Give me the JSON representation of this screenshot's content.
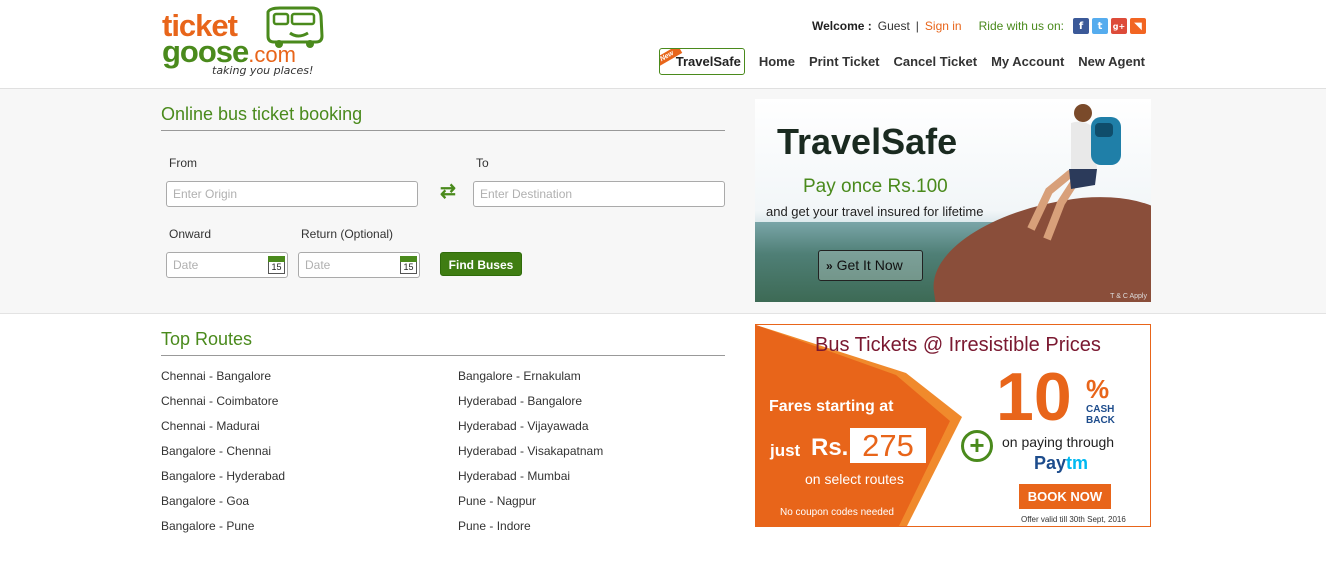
{
  "logo": {
    "line1": "ticket",
    "line2": "goose",
    "dotcom": ".com",
    "tagline": "taking you places!"
  },
  "header": {
    "welcome_label": "Welcome :",
    "user": "Guest",
    "separator": "|",
    "signin": "Sign in",
    "ride_label": "Ride with us on:",
    "social": [
      {
        "icon": "facebook-icon",
        "glyph": "f"
      },
      {
        "icon": "twitter-icon",
        "glyph": "t"
      },
      {
        "icon": "googleplus-icon",
        "glyph": "g+"
      },
      {
        "icon": "rss-icon",
        "glyph": "◥"
      }
    ]
  },
  "nav": {
    "badge": "New",
    "travelsafe": "TravelSafe",
    "items": [
      "Home",
      "Print Ticket",
      "Cancel Ticket",
      "My Account",
      "New Agent"
    ]
  },
  "search": {
    "title": "Online bus ticket booking",
    "from_label": "From",
    "to_label": "To",
    "origin_placeholder": "Enter Origin",
    "destination_placeholder": "Enter Destination",
    "onward_label": "Onward",
    "return_label": "Return (Optional)",
    "date_placeholder": "Date",
    "calendar_day": "15",
    "find_button": "Find Buses",
    "swap_glyph": "⇄"
  },
  "travelsafe_banner": {
    "title": "TravelSafe",
    "pay_line": "Pay once Rs.100",
    "sub_line": "and get your travel insured for lifetime",
    "cta_arrows": "»",
    "cta": "Get It Now",
    "terms": "T & C Apply"
  },
  "routes": {
    "title": "Top Routes",
    "left": [
      "Chennai - Bangalore",
      "Chennai - Coimbatore",
      "Chennai - Madurai",
      "Bangalore - Chennai",
      "Bangalore - Hyderabad",
      "Bangalore - Goa",
      "Bangalore - Pune"
    ],
    "right": [
      "Bangalore - Ernakulam",
      "Hyderabad - Bangalore",
      "Hyderabad - Vijayawada",
      "Hyderabad - Visakapatnam",
      "Hyderabad - Mumbai",
      "Pune - Nagpur",
      "Pune - Indore"
    ]
  },
  "paytm_banner": {
    "headline": "Bus Tickets @ Irresistible Prices",
    "fares": "Fares starting at",
    "just": "just",
    "rs": "Rs.",
    "price": "275",
    "select_routes": "on select routes",
    "no_coupon": "No coupon codes needed",
    "plus": "+",
    "ten": "10",
    "percent": "%",
    "cash": "CASH",
    "back": "BACK",
    "paying": "on paying through",
    "paytm_pay": "Pay",
    "paytm_tm": "tm",
    "book": "BOOK NOW",
    "offer": "Offer valid till 30th Sept, 2016"
  },
  "colors": {
    "brand_green": "#4a8a1c",
    "brand_orange": "#e8651a",
    "button_green": "#3f7d12"
  }
}
